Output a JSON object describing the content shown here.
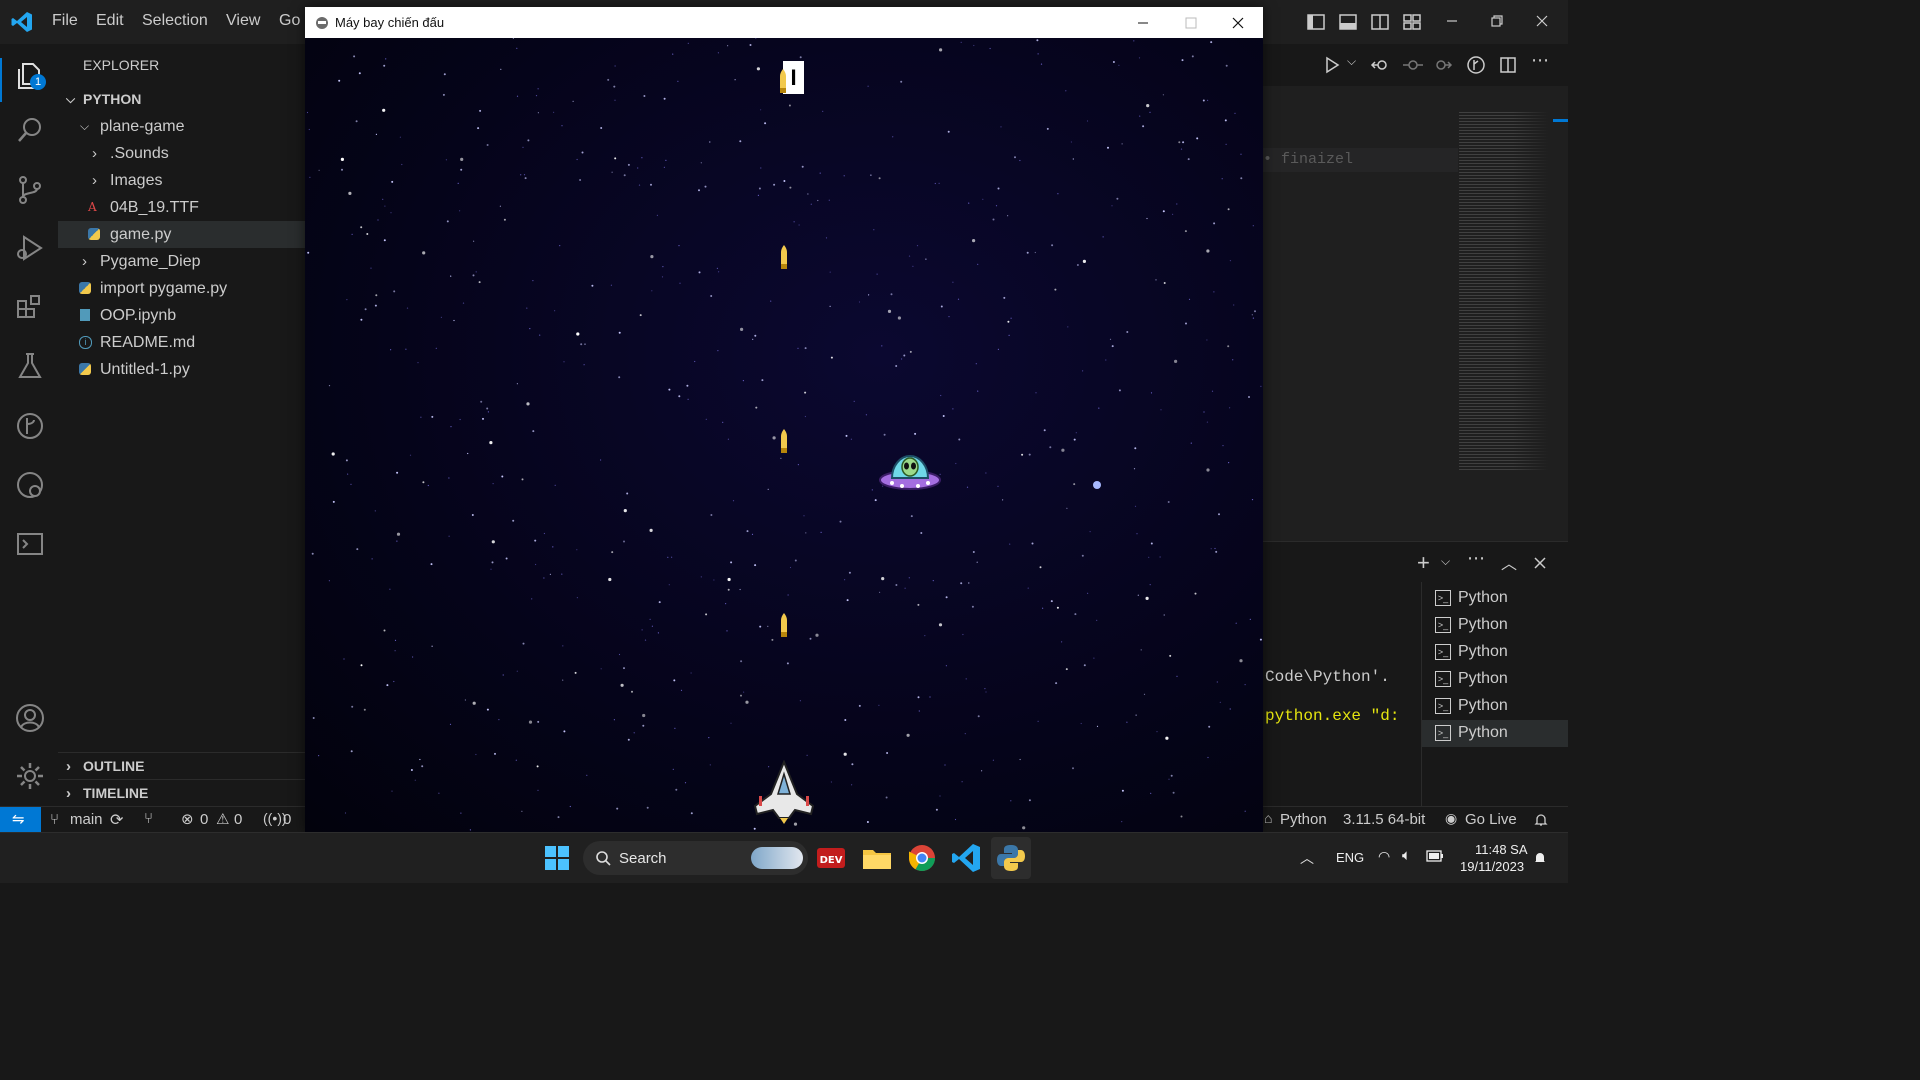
{
  "vscode": {
    "menu": [
      "File",
      "Edit",
      "Selection",
      "View",
      "Go"
    ],
    "explorer": {
      "title": "EXPLORER",
      "badge": "1",
      "root": "PYTHON",
      "folder": "plane-game",
      "subfolders": [
        ".Sounds",
        "Images"
      ],
      "font_file": "04B_19.TTF",
      "active_file": "game.py",
      "folder2": "Pygame_Diep",
      "files": [
        "import pygame.py",
        "OOP.ipynb",
        "README.md",
        "Untitled-1.py"
      ],
      "outline": "OUTLINE",
      "timeline": "TIMELINE"
    },
    "editor": {
      "fragment": "• finaizel"
    },
    "terminal": {
      "line1": "Code\\Python'.",
      "line2": "python.exe \"d:",
      "tabs": [
        "Python",
        "Python",
        "Python",
        "Python",
        "Python",
        "Python"
      ]
    },
    "statusbar": {
      "branch": "main",
      "errors": "0",
      "warnings": "0",
      "ports": "0",
      "language": "Python",
      "version": "3.11.5 64-bit",
      "golive": "Go Live"
    }
  },
  "game": {
    "window_title": "Máy bay chiến đấu",
    "score": "I"
  },
  "taskbar": {
    "search_label": "Search",
    "lang": "ENG",
    "time": "11:48 SA",
    "date": "19/11/2023"
  }
}
